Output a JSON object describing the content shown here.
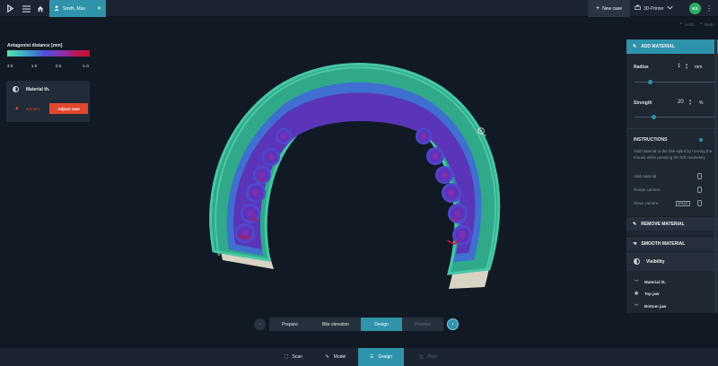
{
  "topbar": {
    "case_name": "Smith, Max",
    "new_case_label": "New case",
    "printer_label": "3D-Printer",
    "user_initials": "KS"
  },
  "history": {
    "undo_label": "Undo",
    "redo_label": "Redo"
  },
  "legend": {
    "title": "Antagonist distance [mm]",
    "ticks": [
      "2.0",
      "1.0",
      "0.0",
      "-1.0"
    ]
  },
  "material_panel": {
    "title": "Material th.",
    "value": "0.6 mm",
    "adjust_label": "Adjust now"
  },
  "wizard": {
    "steps": [
      {
        "label": "Prepare",
        "state": "done"
      },
      {
        "label": "Bite elevation",
        "state": "done"
      },
      {
        "label": "Design",
        "state": "active"
      },
      {
        "label": "Preview",
        "state": "disabled"
      }
    ]
  },
  "bottom_tabs": [
    {
      "label": "Scan",
      "state": "normal"
    },
    {
      "label": "Model",
      "state": "normal"
    },
    {
      "label": "Design",
      "state": "active"
    },
    {
      "label": "Print",
      "state": "disabled"
    }
  ],
  "tool_panel": {
    "add_material_label": "ADD MATERIAL",
    "radius": {
      "label": "Radius",
      "value": "1",
      "unit": "mm",
      "slider_fraction": 0.2
    },
    "strength": {
      "label": "Strength",
      "value": "20",
      "unit": "%",
      "slider_fraction": 0.25
    },
    "instructions_title": "INSTRUCTIONS",
    "instructions_text": "Add material to the bite splint by moving the mouse while pressing the left mousekey.",
    "shortcuts": [
      {
        "label": "Add material",
        "key": ""
      },
      {
        "label": "Rotate camera",
        "key": ""
      },
      {
        "label": "Move camera",
        "key": "SPACE"
      }
    ],
    "remove_material_label": "REMOVE MATERIAL",
    "smooth_material_label": "SMOOTH MATERIAL",
    "visibility_title": "Visibility",
    "visibility_items": [
      {
        "label": "Material th.",
        "icon": "chevron-down-icon"
      },
      {
        "label": "Top jaw",
        "icon": "eye-icon"
      },
      {
        "label": "Bottom jaw",
        "icon": "chevron-down-icon"
      }
    ]
  },
  "colors": {
    "accent": "#2e93ab",
    "warning": "#e2472d",
    "background": "#111a24",
    "splint_green": "#2e9e84",
    "splint_purple": "#5a2fb0"
  }
}
